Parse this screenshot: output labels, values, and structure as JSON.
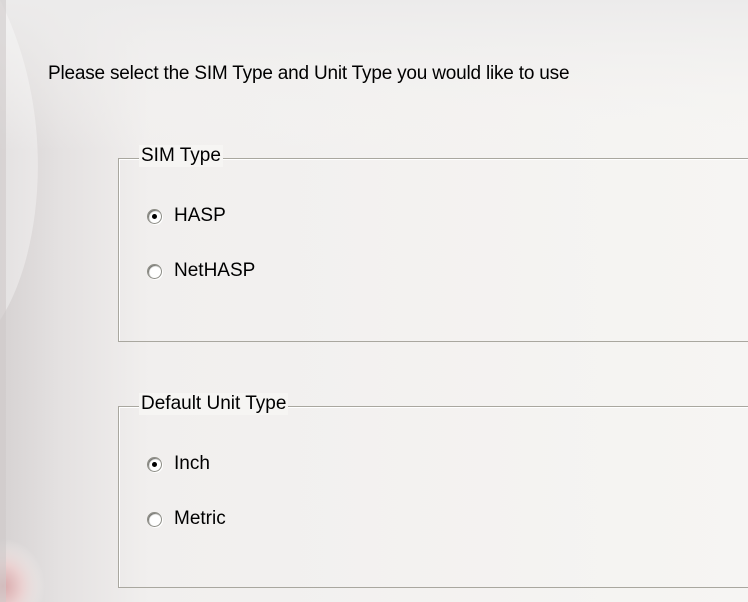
{
  "prompt": "Please select the SIM Type and Unit Type you would like to use",
  "sim_type": {
    "legend": "SIM Type",
    "options": [
      {
        "label": "HASP",
        "checked": true
      },
      {
        "label": "NetHASP",
        "checked": false
      }
    ]
  },
  "unit_type": {
    "legend": "Default Unit Type",
    "options": [
      {
        "label": "Inch",
        "checked": true
      },
      {
        "label": "Metric",
        "checked": false
      }
    ]
  }
}
